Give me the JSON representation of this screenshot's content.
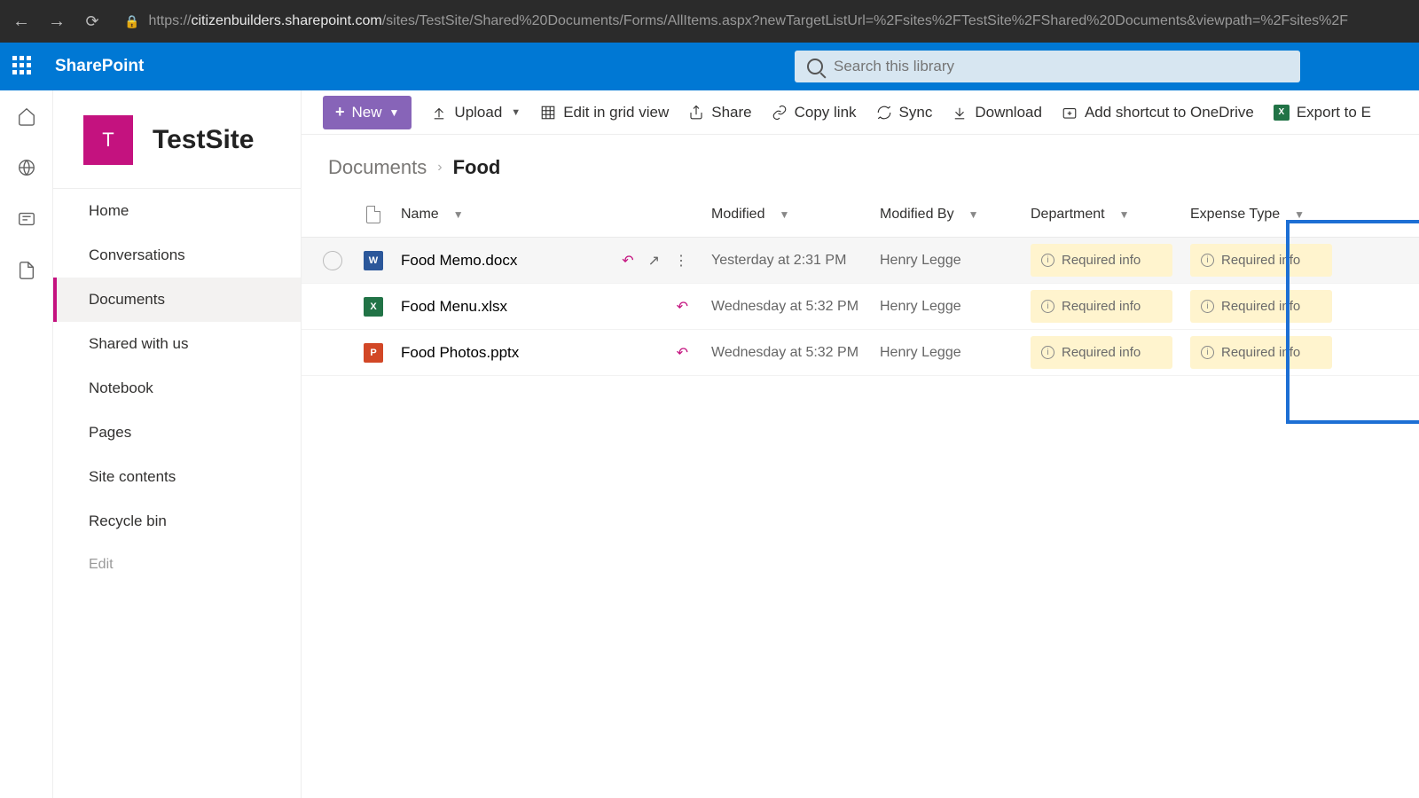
{
  "browser": {
    "url": "https://citizenbuilders.sharepoint.com/sites/TestSite/Shared%20Documents/Forms/AllItems.aspx?newTargetListUrl=%2Fsites%2FTestSite%2FShared%20Documents&viewpath=%2Fsites%2F",
    "url_host": "citizenbuilders.sharepoint.com",
    "url_path": "/sites/TestSite/Shared%20Documents/Forms/AllItems.aspx?newTargetListUrl=%2Fsites%2FTestSite%2FShared%20Documents&viewpath=%2Fsites%2F"
  },
  "header": {
    "brand": "SharePoint",
    "search_placeholder": "Search this library"
  },
  "site": {
    "logo_letter": "T",
    "title": "TestSite"
  },
  "nav": {
    "items": [
      {
        "label": "Home"
      },
      {
        "label": "Conversations"
      },
      {
        "label": "Documents",
        "selected": true
      },
      {
        "label": "Shared with us"
      },
      {
        "label": "Notebook"
      },
      {
        "label": "Pages"
      },
      {
        "label": "Site contents"
      },
      {
        "label": "Recycle bin"
      }
    ],
    "edit": "Edit"
  },
  "toolbar": {
    "new": "New",
    "upload": "Upload",
    "edit_grid": "Edit in grid view",
    "share": "Share",
    "copy_link": "Copy link",
    "sync": "Sync",
    "download": "Download",
    "shortcut": "Add shortcut to OneDrive",
    "export": "Export to E"
  },
  "breadcrumb": {
    "root": "Documents",
    "current": "Food"
  },
  "columns": {
    "name": "Name",
    "modified": "Modified",
    "modified_by": "Modified By",
    "department": "Department",
    "expense_type": "Expense Type"
  },
  "files": [
    {
      "name": "Food Memo.docx",
      "type": "docx",
      "type_label": "W",
      "modified": "Yesterday at 2:31 PM",
      "modified_by": "Henry Legge",
      "department": "Required info",
      "expense_type": "Required info",
      "hovered": true
    },
    {
      "name": "Food Menu.xlsx",
      "type": "xlsx",
      "type_label": "X",
      "modified": "Wednesday at 5:32 PM",
      "modified_by": "Henry Legge",
      "department": "Required info",
      "expense_type": "Required info"
    },
    {
      "name": "Food Photos.pptx",
      "type": "pptx",
      "type_label": "P",
      "modified": "Wednesday at 5:32 PM",
      "modified_by": "Henry Legge",
      "department": "Required info",
      "expense_type": "Required info"
    }
  ]
}
